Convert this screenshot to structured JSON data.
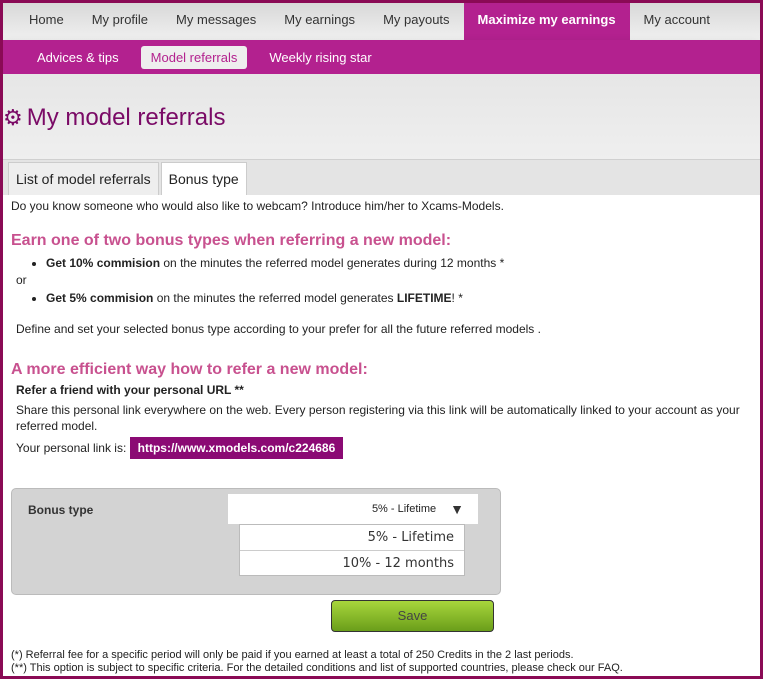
{
  "topnav": [
    "Home",
    "My profile",
    "My messages",
    "My earnings",
    "My payouts",
    "Maximize my earnings",
    "My account"
  ],
  "subnav": [
    "Advices & tips",
    "Model referrals",
    "Weekly rising star"
  ],
  "page_title": "My model referrals",
  "tabs": [
    "List of model referrals",
    "Bonus type"
  ],
  "intro": "Do you know someone who would also like to webcam? Introduce him/her to Xcams-Models.",
  "heading1": "Earn one of two bonus types when referring a new model:",
  "opt1_bold": "Get 10% commision",
  "opt1_rest": " on the minutes the referred model generates during 12 months *",
  "or": "or",
  "opt2_bold": "Get 5% commision",
  "opt2_rest": " on the minutes the referred model generates ",
  "opt2_life": "LIFETIME",
  "opt2_end": "! *",
  "define": "Define and set your selected bonus type according to your prefer for all the future referred models .",
  "heading2": "A more efficient way how to refer a new model:",
  "refer_title": "Refer a friend with your personal URL **",
  "share": "Share this personal link everywhere on the web. Every person registering via this link will be automatically linked to your account as your referred model.",
  "link_label": "Your personal link is:",
  "link": "https://www.xmodels.com/c224686",
  "bonus_label": "Bonus type",
  "selected": "5% - Lifetime",
  "options": [
    "5% - Lifetime",
    "10% - 12 months"
  ],
  "save": "Save",
  "foot1": "(*) Referral fee for a specific period will only be paid if you earned at least a total of 250 Credits in the 2 last periods.",
  "foot2": "(**) This option is subject to specific criteria. For the detailed conditions and list of supported countries, please check our FAQ.",
  "colors": {
    "brand": "#b3218f",
    "border": "#8a0a55",
    "save": "#8cc22c"
  }
}
